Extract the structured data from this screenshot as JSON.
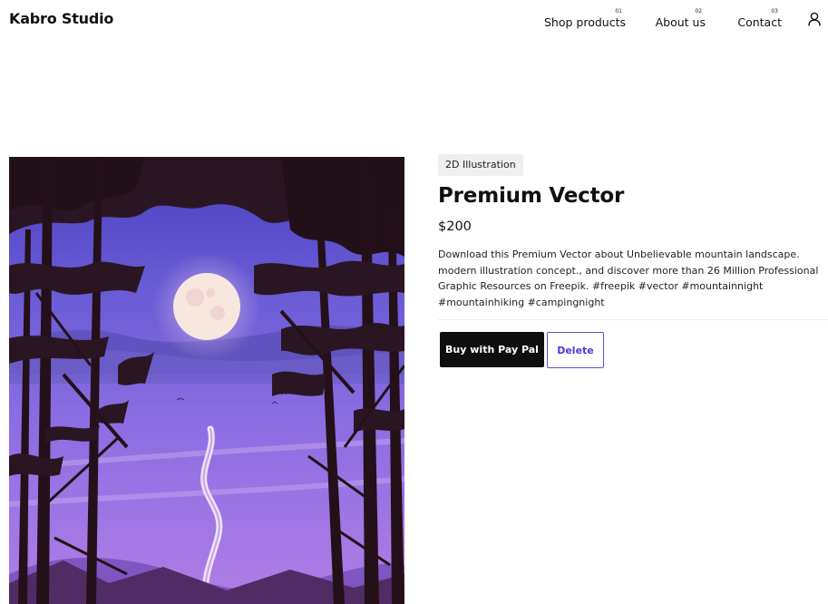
{
  "header": {
    "logo": "Kabro Studio",
    "nav": [
      {
        "num": "01",
        "label": "Shop products"
      },
      {
        "num": "02",
        "label": "About us"
      },
      {
        "num": "03",
        "label": "Contact"
      }
    ],
    "user_icon": "user-icon"
  },
  "product": {
    "image_icon": "landscape-illustration",
    "tag": "2D Illustration",
    "title": "Premium Vector",
    "price": "$200",
    "description": "Download this Premium Vector about Unbelievable mountain landscape.\nmodern illustration concept., and discover more than 26 Million Professional\nGraphic Resources on Freepik. #freepik #vector #mountainnight\n#mountainhiking #campingnight",
    "buy_label": "Buy with Pay Pal",
    "delete_label": "Delete"
  },
  "colors": {
    "button_dark": "#0f0f0f",
    "accent": "#4c3bd6",
    "tag_bg": "#efefef"
  }
}
